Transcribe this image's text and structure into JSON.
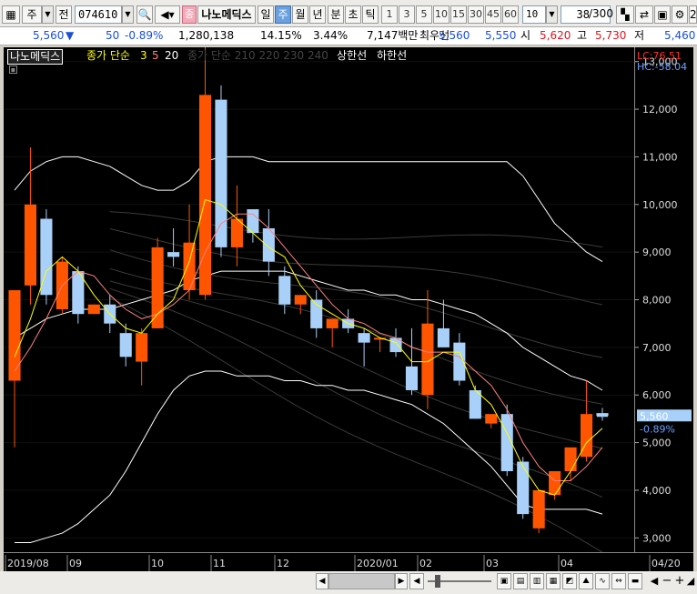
{
  "toolbar": {
    "menu_label": "주",
    "view_label": "전",
    "code": "074610",
    "name": "나노메딕스",
    "periods": [
      "일",
      "주",
      "월",
      "년",
      "분",
      "초",
      "틱"
    ],
    "period_selected": "주",
    "intervals": [
      "1",
      "3",
      "5",
      "10",
      "15",
      "30",
      "45",
      "60"
    ],
    "count": "10",
    "page": "38",
    "page_total": "/300",
    "right_cut": "2"
  },
  "quote": {
    "price": "5,560",
    "change_arrow": "▼",
    "change": "50",
    "change_pct": "-0.89%",
    "volume": "1,280,138",
    "pct2": "14.15%",
    "pct3": "3.44%",
    "amount": "7,147백만",
    "best_label": "최우선",
    "best_ask": "5,560",
    "best_bid": "5,550",
    "open_label": "시",
    "open": "5,620",
    "high_label": "고",
    "high": "5,730",
    "low_label": "저",
    "low": "5,460"
  },
  "legend": {
    "name": "나노메딕스",
    "ma_title": "종가 단순",
    "ma_periods": [
      "3",
      "5",
      "20"
    ],
    "ma_dim": "종가 단순 210 220 230 240",
    "limit_up": "상한선",
    "limit_down": "하한선"
  },
  "axis_info": {
    "lc": "LC:76.51",
    "hc": "HC:-58.04",
    "last_price": "5,560",
    "last_pct": "-0.89%"
  },
  "x_labels": [
    "2019/08",
    "09",
    "10",
    "11",
    "12",
    "2020/01",
    "02",
    "03",
    "04",
    "04/20"
  ],
  "colors": {
    "up": "#ff5500",
    "down": "#a8d0f8",
    "ma3": "#ffff00",
    "ma5": "#ff8080",
    "band": "#ffffff",
    "selected_tab": "#6aa0e0"
  },
  "chart_data": {
    "type": "candlestick",
    "ylim": [
      2700,
      13300
    ],
    "y_ticks": [
      "13,000",
      "12,000",
      "11,000",
      "10,000",
      "9,000",
      "8,000",
      "7,000",
      "6,000",
      "5,000",
      "4,000",
      "3,000"
    ],
    "candles": [
      {
        "o": 6300,
        "h": 7500,
        "l": 4900,
        "c": 8200
      },
      {
        "o": 8300,
        "h": 11200,
        "l": 7900,
        "c": 10000
      },
      {
        "o": 9700,
        "h": 9900,
        "l": 7900,
        "c": 8100
      },
      {
        "o": 7800,
        "h": 8900,
        "l": 7700,
        "c": 8800
      },
      {
        "o": 8600,
        "h": 8700,
        "l": 7500,
        "c": 7700
      },
      {
        "o": 7700,
        "h": 7900,
        "l": 7700,
        "c": 7900
      },
      {
        "o": 7900,
        "h": 8100,
        "l": 7300,
        "c": 7500
      },
      {
        "o": 7300,
        "h": 7500,
        "l": 6600,
        "c": 6800
      },
      {
        "o": 6700,
        "h": 7400,
        "l": 6200,
        "c": 7300
      },
      {
        "o": 7400,
        "h": 9300,
        "l": 7400,
        "c": 9100
      },
      {
        "o": 9000,
        "h": 9500,
        "l": 8700,
        "c": 8900
      },
      {
        "o": 8200,
        "h": 10000,
        "l": 8000,
        "c": 9200
      },
      {
        "o": 8100,
        "h": 13300,
        "l": 8000,
        "c": 12300
      },
      {
        "o": 12200,
        "h": 12500,
        "l": 8900,
        "c": 9100
      },
      {
        "o": 9100,
        "h": 10400,
        "l": 8700,
        "c": 9700
      },
      {
        "o": 9900,
        "h": 9900,
        "l": 9200,
        "c": 9400
      },
      {
        "o": 9500,
        "h": 9900,
        "l": 8500,
        "c": 8800
      },
      {
        "o": 8500,
        "h": 8700,
        "l": 7700,
        "c": 7900
      },
      {
        "o": 7900,
        "h": 8100,
        "l": 7700,
        "c": 8100
      },
      {
        "o": 8000,
        "h": 8200,
        "l": 7200,
        "c": 7400
      },
      {
        "o": 7400,
        "h": 7500,
        "l": 7000,
        "c": 7600
      },
      {
        "o": 7600,
        "h": 7800,
        "l": 7300,
        "c": 7400
      },
      {
        "o": 7300,
        "h": 7400,
        "l": 6600,
        "c": 7100
      },
      {
        "o": 7200,
        "h": 7200,
        "l": 6900,
        "c": 7200
      },
      {
        "o": 7200,
        "h": 7400,
        "l": 6800,
        "c": 6900
      },
      {
        "o": 6600,
        "h": 7400,
        "l": 6000,
        "c": 6100
      },
      {
        "o": 6000,
        "h": 8200,
        "l": 5700,
        "c": 7500
      },
      {
        "o": 7400,
        "h": 8000,
        "l": 7200,
        "c": 7000
      },
      {
        "o": 7100,
        "h": 7300,
        "l": 6200,
        "c": 6300
      },
      {
        "o": 6100,
        "h": 6200,
        "l": 5500,
        "c": 5500
      },
      {
        "o": 5400,
        "h": 5500,
        "l": 5300,
        "c": 5600
      },
      {
        "o": 5600,
        "h": 5800,
        "l": 4300,
        "c": 4400
      },
      {
        "o": 4600,
        "h": 4700,
        "l": 3400,
        "c": 3500
      },
      {
        "o": 3200,
        "h": 3900,
        "l": 3100,
        "c": 4000
      },
      {
        "o": 3900,
        "h": 4400,
        "l": 3800,
        "c": 4400
      },
      {
        "o": 4400,
        "h": 4800,
        "l": 4200,
        "c": 4900
      },
      {
        "o": 4700,
        "h": 6300,
        "l": 4600,
        "c": 5600
      },
      {
        "o": 5620,
        "h": 5730,
        "l": 5460,
        "c": 5560
      }
    ],
    "ma3": [
      6800,
      7600,
      8600,
      8900,
      8600,
      8100,
      7700,
      7400,
      7300,
      7700,
      8000,
      8800,
      10100,
      10000,
      9700,
      9400,
      9100,
      8900,
      8300,
      7900,
      7700,
      7500,
      7400,
      7200,
      7100,
      6700,
      6700,
      6900,
      6900,
      6100,
      5800,
      5200,
      4500,
      4000,
      3900,
      4400,
      5000,
      5300
    ],
    "ma5": [
      6500,
      7000,
      7600,
      8300,
      8600,
      8500,
      8100,
      7800,
      7600,
      7700,
      7900,
      8200,
      9000,
      9600,
      9800,
      9800,
      9500,
      9100,
      8700,
      8300,
      7900,
      7600,
      7500,
      7300,
      7200,
      7000,
      6900,
      6900,
      6800,
      6500,
      6200,
      5700,
      5000,
      4500,
      4200,
      4200,
      4500,
      4900
    ],
    "band_upper": [
      10300,
      10700,
      10900,
      11000,
      11000,
      10900,
      10800,
      10600,
      10400,
      10300,
      10300,
      10500,
      10900,
      11000,
      11000,
      11000,
      10900,
      10900,
      10900,
      10900,
      10900,
      10900,
      10900,
      10900,
      10900,
      10900,
      10900,
      10900,
      10900,
      10900,
      10900,
      10900,
      10600,
      10100,
      9600,
      9300,
      9000,
      8800
    ],
    "band_mid": [
      7200,
      7400,
      7600,
      7700,
      7800,
      7800,
      7800,
      7900,
      8000,
      8100,
      8200,
      8400,
      8500,
      8600,
      8600,
      8600,
      8600,
      8600,
      8500,
      8400,
      8300,
      8200,
      8200,
      8100,
      8100,
      8000,
      8000,
      7900,
      7800,
      7700,
      7500,
      7300,
      7000,
      6800,
      6600,
      6400,
      6300,
      6100
    ],
    "band_lower": [
      2900,
      2900,
      3000,
      3100,
      3300,
      3600,
      3900,
      4400,
      5000,
      5600,
      6100,
      6400,
      6500,
      6500,
      6400,
      6400,
      6400,
      6300,
      6300,
      6200,
      6200,
      6100,
      6100,
      6000,
      5900,
      5800,
      5600,
      5400,
      5100,
      4800,
      4500,
      4100,
      3700,
      3600,
      3600,
      3600,
      3600,
      3500
    ]
  },
  "scroll": {
    "arrows": [
      "◀",
      "▶"
    ]
  }
}
